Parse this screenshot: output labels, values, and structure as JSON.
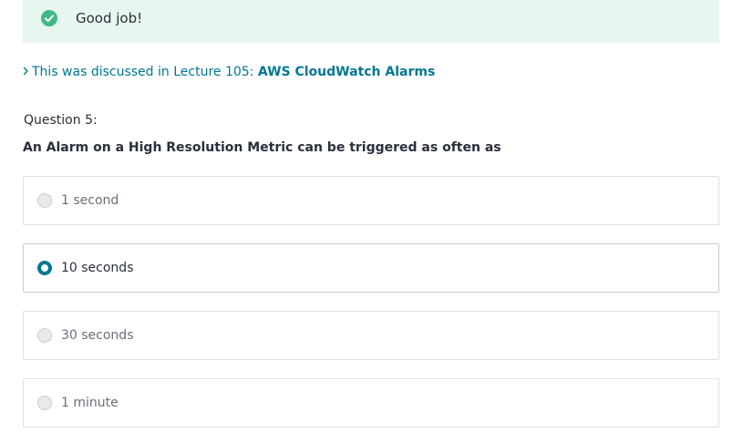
{
  "feedback": {
    "message": "Good job!",
    "icon": "check-circle-icon",
    "color": "#3fb984"
  },
  "reference": {
    "prefix": "This was discussed in Lecture 105:",
    "lecture_link": "AWS CloudWatch Alarms"
  },
  "question": {
    "number_label": "Question 5:",
    "text": "An Alarm on a High Resolution Metric can be triggered as often as"
  },
  "options": [
    {
      "label": "1 second",
      "selected": false
    },
    {
      "label": "10 seconds",
      "selected": true
    },
    {
      "label": "30 seconds",
      "selected": false
    },
    {
      "label": "1 minute",
      "selected": false
    }
  ],
  "colors": {
    "accent": "#007791",
    "success_bg": "#e7f6ef"
  }
}
